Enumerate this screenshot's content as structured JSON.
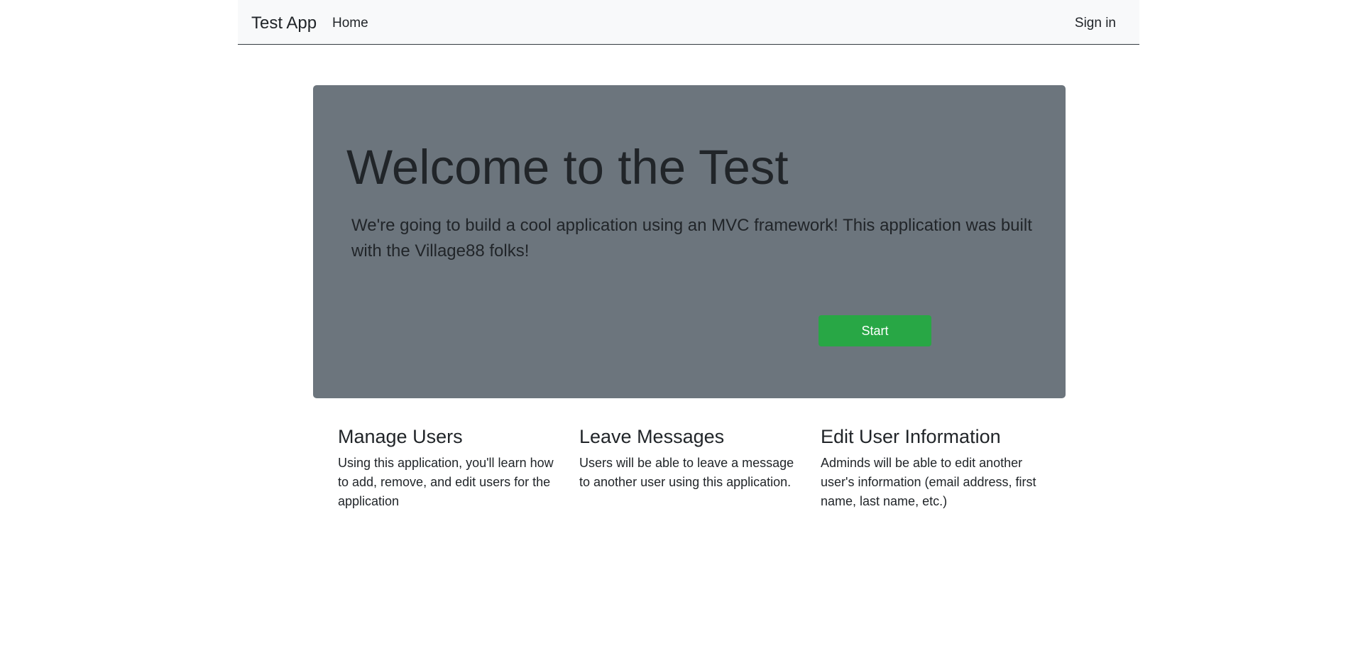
{
  "navbar": {
    "brand": "Test App",
    "home_label": "Home",
    "signin_label": "Sign in"
  },
  "jumbotron": {
    "title": "Welcome to the Test",
    "lead": "We're going to build a cool application using an MVC framework! This application was built with the Village88 folks!",
    "button_label": "Start"
  },
  "features": [
    {
      "title": "Manage Users",
      "text": "Using this application, you'll learn how to add, remove, and edit users for the application"
    },
    {
      "title": "Leave Messages",
      "text": "Users will be able to leave a message to another user using this application."
    },
    {
      "title": "Edit User Information",
      "text": "Adminds will be able to edit another user's information (email address, first name, last name, etc.)"
    }
  ],
  "colors": {
    "navbar_bg": "#f8f9fa",
    "jumbotron_bg": "#6c757d",
    "button_bg": "#28a745",
    "text": "#212529"
  }
}
